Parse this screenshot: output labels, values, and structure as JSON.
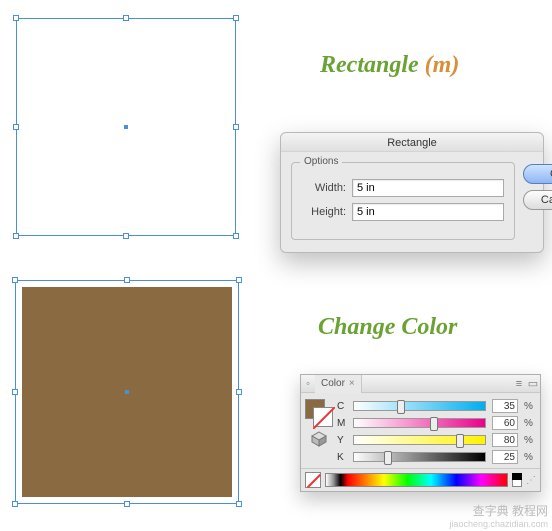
{
  "titles": {
    "rectangle_a": "Rectangle ",
    "rectangle_b": "(m)",
    "change_color": "Change Color"
  },
  "dialog": {
    "title": "Rectangle",
    "legend": "Options",
    "width_label": "Width:",
    "height_label": "Height:",
    "width_value": "5 in",
    "height_value": "5 in",
    "ok": "OK",
    "cancel": "Cancel"
  },
  "color_panel": {
    "tab": "Color",
    "channels": {
      "c": {
        "label": "C",
        "value": "35",
        "pct": "%"
      },
      "m": {
        "label": "M",
        "value": "60",
        "pct": "%"
      },
      "y": {
        "label": "Y",
        "value": "80",
        "pct": "%"
      },
      "k": {
        "label": "K",
        "value": "25",
        "pct": "%"
      }
    }
  },
  "watermark": {
    "line1": "查字典 教程网",
    "line2": "jiaocheng.chazidian.com"
  }
}
